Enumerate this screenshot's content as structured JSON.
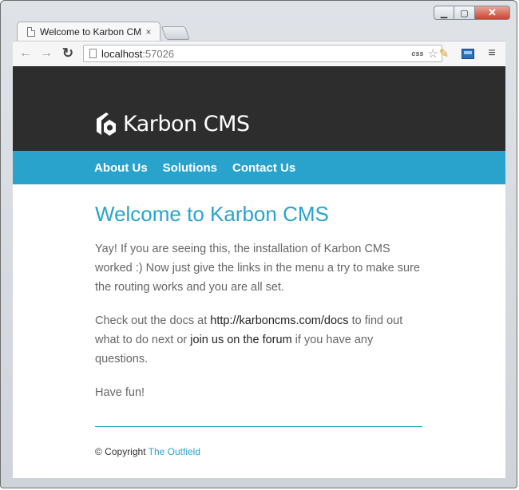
{
  "window": {
    "caption_buttons": {
      "minimize_icon": "minimize-icon",
      "maximize_icon": "maximize-icon",
      "close_icon": "close-icon"
    }
  },
  "browser": {
    "tab": {
      "title": "Welcome to Karbon CMS",
      "close_glyph": "×"
    },
    "toolbar": {
      "back_glyph": "←",
      "forward_glyph": "→",
      "reload_glyph": "↻",
      "url_host": "localhost",
      "url_port": ":57026",
      "css_extension": "css",
      "star_glyph": "☆",
      "pencil_glyph": "✎",
      "menu_glyph": "≡"
    }
  },
  "site": {
    "logo_text": "Karbon CMS",
    "nav": [
      "About Us",
      "Solutions",
      "Contact Us"
    ],
    "heading": "Welcome to Karbon CMS",
    "paragraph1": "Yay! If you are seeing this, the installation of Karbon CMS worked :) Now just give the links in the menu a try to make sure the routing works and you are all set.",
    "paragraph2": {
      "before_link": "Check out the docs at ",
      "docs_link": "http://karboncms.com/docs",
      "middle": " to find out what to do next or ",
      "forum_link": "join us on the forum",
      "after": " if you have any questions."
    },
    "paragraph3": "Have fun!",
    "footer": {
      "copyright": "© Copyright ",
      "company": "The Outfield"
    }
  },
  "colors": {
    "header_bg": "#2d2d2d",
    "nav_bg": "#29a3cc",
    "accent": "#29a3cc",
    "body_text": "#666666"
  }
}
